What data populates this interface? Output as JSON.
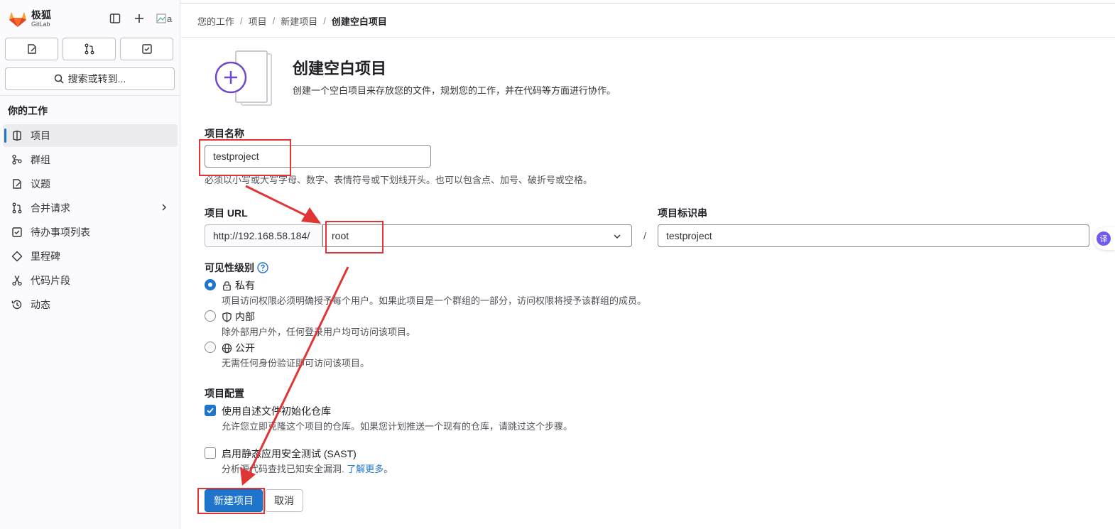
{
  "brand": {
    "name": "极狐",
    "sub": "GitLab",
    "avatar_alt": "a"
  },
  "sidebar": {
    "search_label": "搜索或转到...",
    "section_title": "你的工作",
    "items": [
      {
        "label": "项目",
        "icon": "project-icon",
        "active": true
      },
      {
        "label": "群组",
        "icon": "group-icon"
      },
      {
        "label": "议题",
        "icon": "issues-icon"
      },
      {
        "label": "合并请求",
        "icon": "merge-request-icon",
        "has_children": true
      },
      {
        "label": "待办事项列表",
        "icon": "todo-icon"
      },
      {
        "label": "里程碑",
        "icon": "milestone-icon"
      },
      {
        "label": "代码片段",
        "icon": "snippet-icon"
      },
      {
        "label": "动态",
        "icon": "activity-icon"
      }
    ]
  },
  "breadcrumb": [
    "您的工作",
    "项目",
    "新建项目",
    "创建空白项目"
  ],
  "header": {
    "title": "创建空白项目",
    "description": "创建一个空白项目来存放您的文件，规划您的工作，并在代码等方面进行协作。"
  },
  "form": {
    "name_label": "项目名称",
    "name_value": "testproject",
    "name_help": "必须以小写或大写字母、数字、表情符号或下划线开头。也可以包含点、加号、破折号或空格。",
    "url_label": "项目 URL",
    "url_prefix": "http://192.168.58.184/",
    "namespace_value": "root",
    "slug_label": "项目标识串",
    "slug_value": "testproject",
    "slash": "/",
    "visibility_label": "可见性级别",
    "visibility_options": [
      {
        "label": "私有",
        "help": "项目访问权限必须明确授予每个用户。如果此项目是一个群组的一部分，访问权限将授予该群组的成员。",
        "checked": true
      },
      {
        "label": "内部",
        "help": "除外部用户外，任何登录用户均可访问该项目。",
        "checked": false
      },
      {
        "label": "公开",
        "help": "无需任何身份验证即可访问该项目。",
        "checked": false
      }
    ],
    "config_label": "项目配置",
    "readme_label": "使用自述文件初始化仓库",
    "readme_help": "允许您立即克隆这个项目的仓库。如果您计划推送一个现有的仓库，请跳过这个步骤。",
    "readme_checked": true,
    "sast_label": "启用静态应用安全测试 (SAST)",
    "sast_help_prefix": "分析源代码查找已知安全漏洞.",
    "sast_link": "了解更多",
    "sast_help_suffix": "。",
    "sast_checked": false,
    "submit_label": "新建项目",
    "cancel_label": "取消"
  },
  "translate_fab": "译",
  "colors": {
    "accent": "#1f75cb",
    "annotation": "#e03535",
    "illustration": "#6e49cb"
  }
}
